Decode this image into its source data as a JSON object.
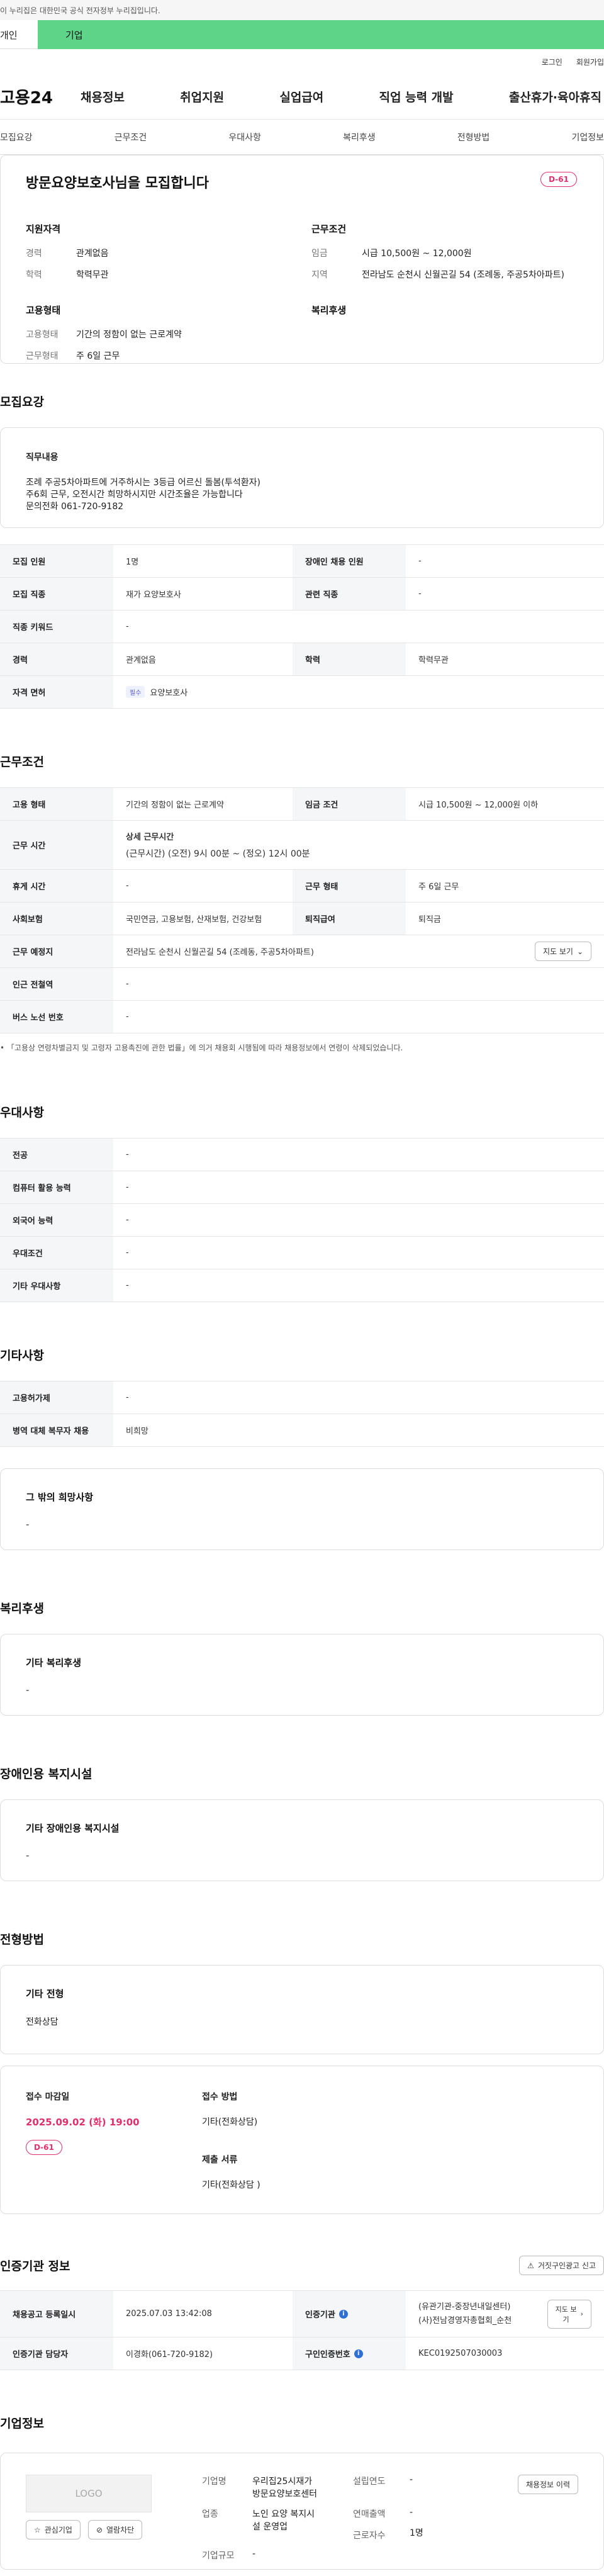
{
  "gov_banner": "이 누리집은 대한민국 공식 전자정부 누리집입니다.",
  "site_tabs": {
    "individual": "개인",
    "company": "기업"
  },
  "util": {
    "login": "로그인",
    "signup": "회원가입"
  },
  "gnb": {
    "logo": "고용24",
    "menu": [
      "채용정보",
      "취업지원",
      "실업급여",
      "직업 능력 개발",
      "출산휴가·육아휴직"
    ]
  },
  "anchor_tabs": [
    "모집요강",
    "근무조건",
    "우대사항",
    "복리후생",
    "전형방법",
    "기업정보"
  ],
  "summary": {
    "title": "방문요양보호사님을 모집합니다",
    "dday": "D-61",
    "qual_title": "지원자격",
    "qual": [
      {
        "k": "경력",
        "v": "관계없음"
      },
      {
        "k": "학력",
        "v": "학력무관"
      }
    ],
    "work_title": "근무조건",
    "work": [
      {
        "k": "임금",
        "v": "시급 10,500원 ~ 12,000원"
      },
      {
        "k": "지역",
        "v": "전라남도 순천시 신월곤길 54 (조례동, 주공5차아파트)"
      }
    ],
    "emp_title": "고용형태",
    "emp": [
      {
        "k": "고용형태",
        "v": "기간의 정함이 없는 근로계약"
      },
      {
        "k": "근무형태",
        "v": "주 6일 근무"
      }
    ],
    "welfare_title": "복리후생"
  },
  "recruit": {
    "title": "모집요강",
    "job_desc_title": "직무내용",
    "job_desc": [
      "조례 주공5차아파트에 거주하시는 3등급 어르신 돌봄(투석환자)",
      "주6회 근무, 오전시간 희망하시지만  시간조율은 가능합니다",
      "문의전화 061-720-9182"
    ],
    "rows": {
      "headcount_k": "모집 인원",
      "headcount_v": "1명",
      "disabled_k": "장애인 채용 인원",
      "disabled_v": "-",
      "job_k": "모집 직종",
      "job_v": "재가 요양보호사",
      "related_k": "관련 직종",
      "related_v": "-",
      "keyword_k": "직종 키워드",
      "keyword_v": "-",
      "career_k": "경력",
      "career_v": "관계없음",
      "edu_k": "학력",
      "edu_v": "학력무관",
      "license_k": "자격 면허",
      "license_badge": "필수",
      "license_v": "요양보호사"
    }
  },
  "work": {
    "title": "근무조건",
    "type_k": "고용 형태",
    "type_v": "기간의 정함이 없는 근로계약",
    "wage_k": "임금 조건",
    "wage_v": "시급 10,500원 ~ 12,000원 이하",
    "time_k": "근무 시간",
    "time_title": "상세 근무시간",
    "time_v": "(근무시간) (오전) 9시 00분 ~ (정오) 12시 00분",
    "holiday_k": "휴게 시간",
    "holiday_v": "-",
    "shape_k": "근무 형태",
    "shape_v": "주 6일 근무",
    "insurance_k": "사회보험",
    "insurance_v": "국민연금, 고용보험, 산재보험, 건강보험",
    "retire_k": "퇴직급여",
    "retire_v": "퇴직금",
    "place_k": "근무 예정지",
    "place_v": "전라남도 순천시 신월곤길 54 (조례동, 주공5차아파트)",
    "map_btn": "지도 보기",
    "station_k": "인근 전철역",
    "station_v": "-",
    "bus_k": "버스 노선 번호",
    "bus_v": "-",
    "note": "「고용상 연령차별금지 및 고령자 고용촉진에 관한 법률」에 의거 채용회 시행됨에 따라 채용정보에서 연령이 삭제되었습니다."
  },
  "pref": {
    "title": "우대사항",
    "rows": [
      {
        "k": "전공",
        "v": "-"
      },
      {
        "k": "컴퓨터 활용 능력",
        "v": "-"
      },
      {
        "k": "외국어 능력",
        "v": "-"
      },
      {
        "k": "우대조건",
        "v": "-"
      },
      {
        "k": "기타 우대사항",
        "v": "-"
      }
    ]
  },
  "etc": {
    "title": "기타사항",
    "rows": [
      {
        "k": "고용허가제",
        "v": "-"
      },
      {
        "k": "병역 대체 복무자 채용",
        "v": "비희망"
      }
    ],
    "other_title": "그 밖의 희망사항",
    "other_v": "-"
  },
  "welfare": {
    "title": "복리후생",
    "box_title": "기타 복리후생",
    "box_v": "-"
  },
  "disabled_fac": {
    "title": "장애인용 복지시설",
    "box_title": "기타 장애인용 복지시설",
    "box_v": "-"
  },
  "screening": {
    "title": "전형방법",
    "box_title": "기타 전형",
    "box_v": "전화상담",
    "deadline_k": "접수 마감일",
    "deadline_v": "2025.09.02 (화) 19:00",
    "dday": "D-61",
    "method_k": "접수 방법",
    "method_v": "기타(전화상담)",
    "docs_k": "제출 서류",
    "docs_v": "기타(전화상담 )"
  },
  "cert": {
    "title": "인증기관 정보",
    "report_btn": "거짓구인광고 신고",
    "reg_k": "채용공고 등록일시",
    "reg_v": "2025.07.03 13:42:08",
    "org_k": "인증기관",
    "org_v1": "(유관기관-중장년내일센터)",
    "org_v2": "(사)전남경영자총협회_순천",
    "map_btn": "지도 보기",
    "manager_k": "인증기관 담당자",
    "manager_v": "이경화(061-720-9182)",
    "certno_k": "구인인증번호",
    "certno_v": "KEC0192507030003"
  },
  "company": {
    "title": "기업정보",
    "logo": "LOGO",
    "fav_btn": "관심기업",
    "block_btn": "열람차단",
    "name_k": "기업명",
    "name_v1": "우리집25시재가",
    "name_v2": "방문요양보호센터",
    "year_k": "설립연도",
    "year_v": "-",
    "ind_k": "업종",
    "ind_v1": "노인 요양 복지시",
    "ind_v2": "설 운영업",
    "sales_k": "연매출액",
    "sales_v": "-",
    "emp_k": "근로자수",
    "emp_v": "1명",
    "scale_k": "기업규모",
    "scale_v": "-",
    "history_btn": "채용정보 이력"
  }
}
